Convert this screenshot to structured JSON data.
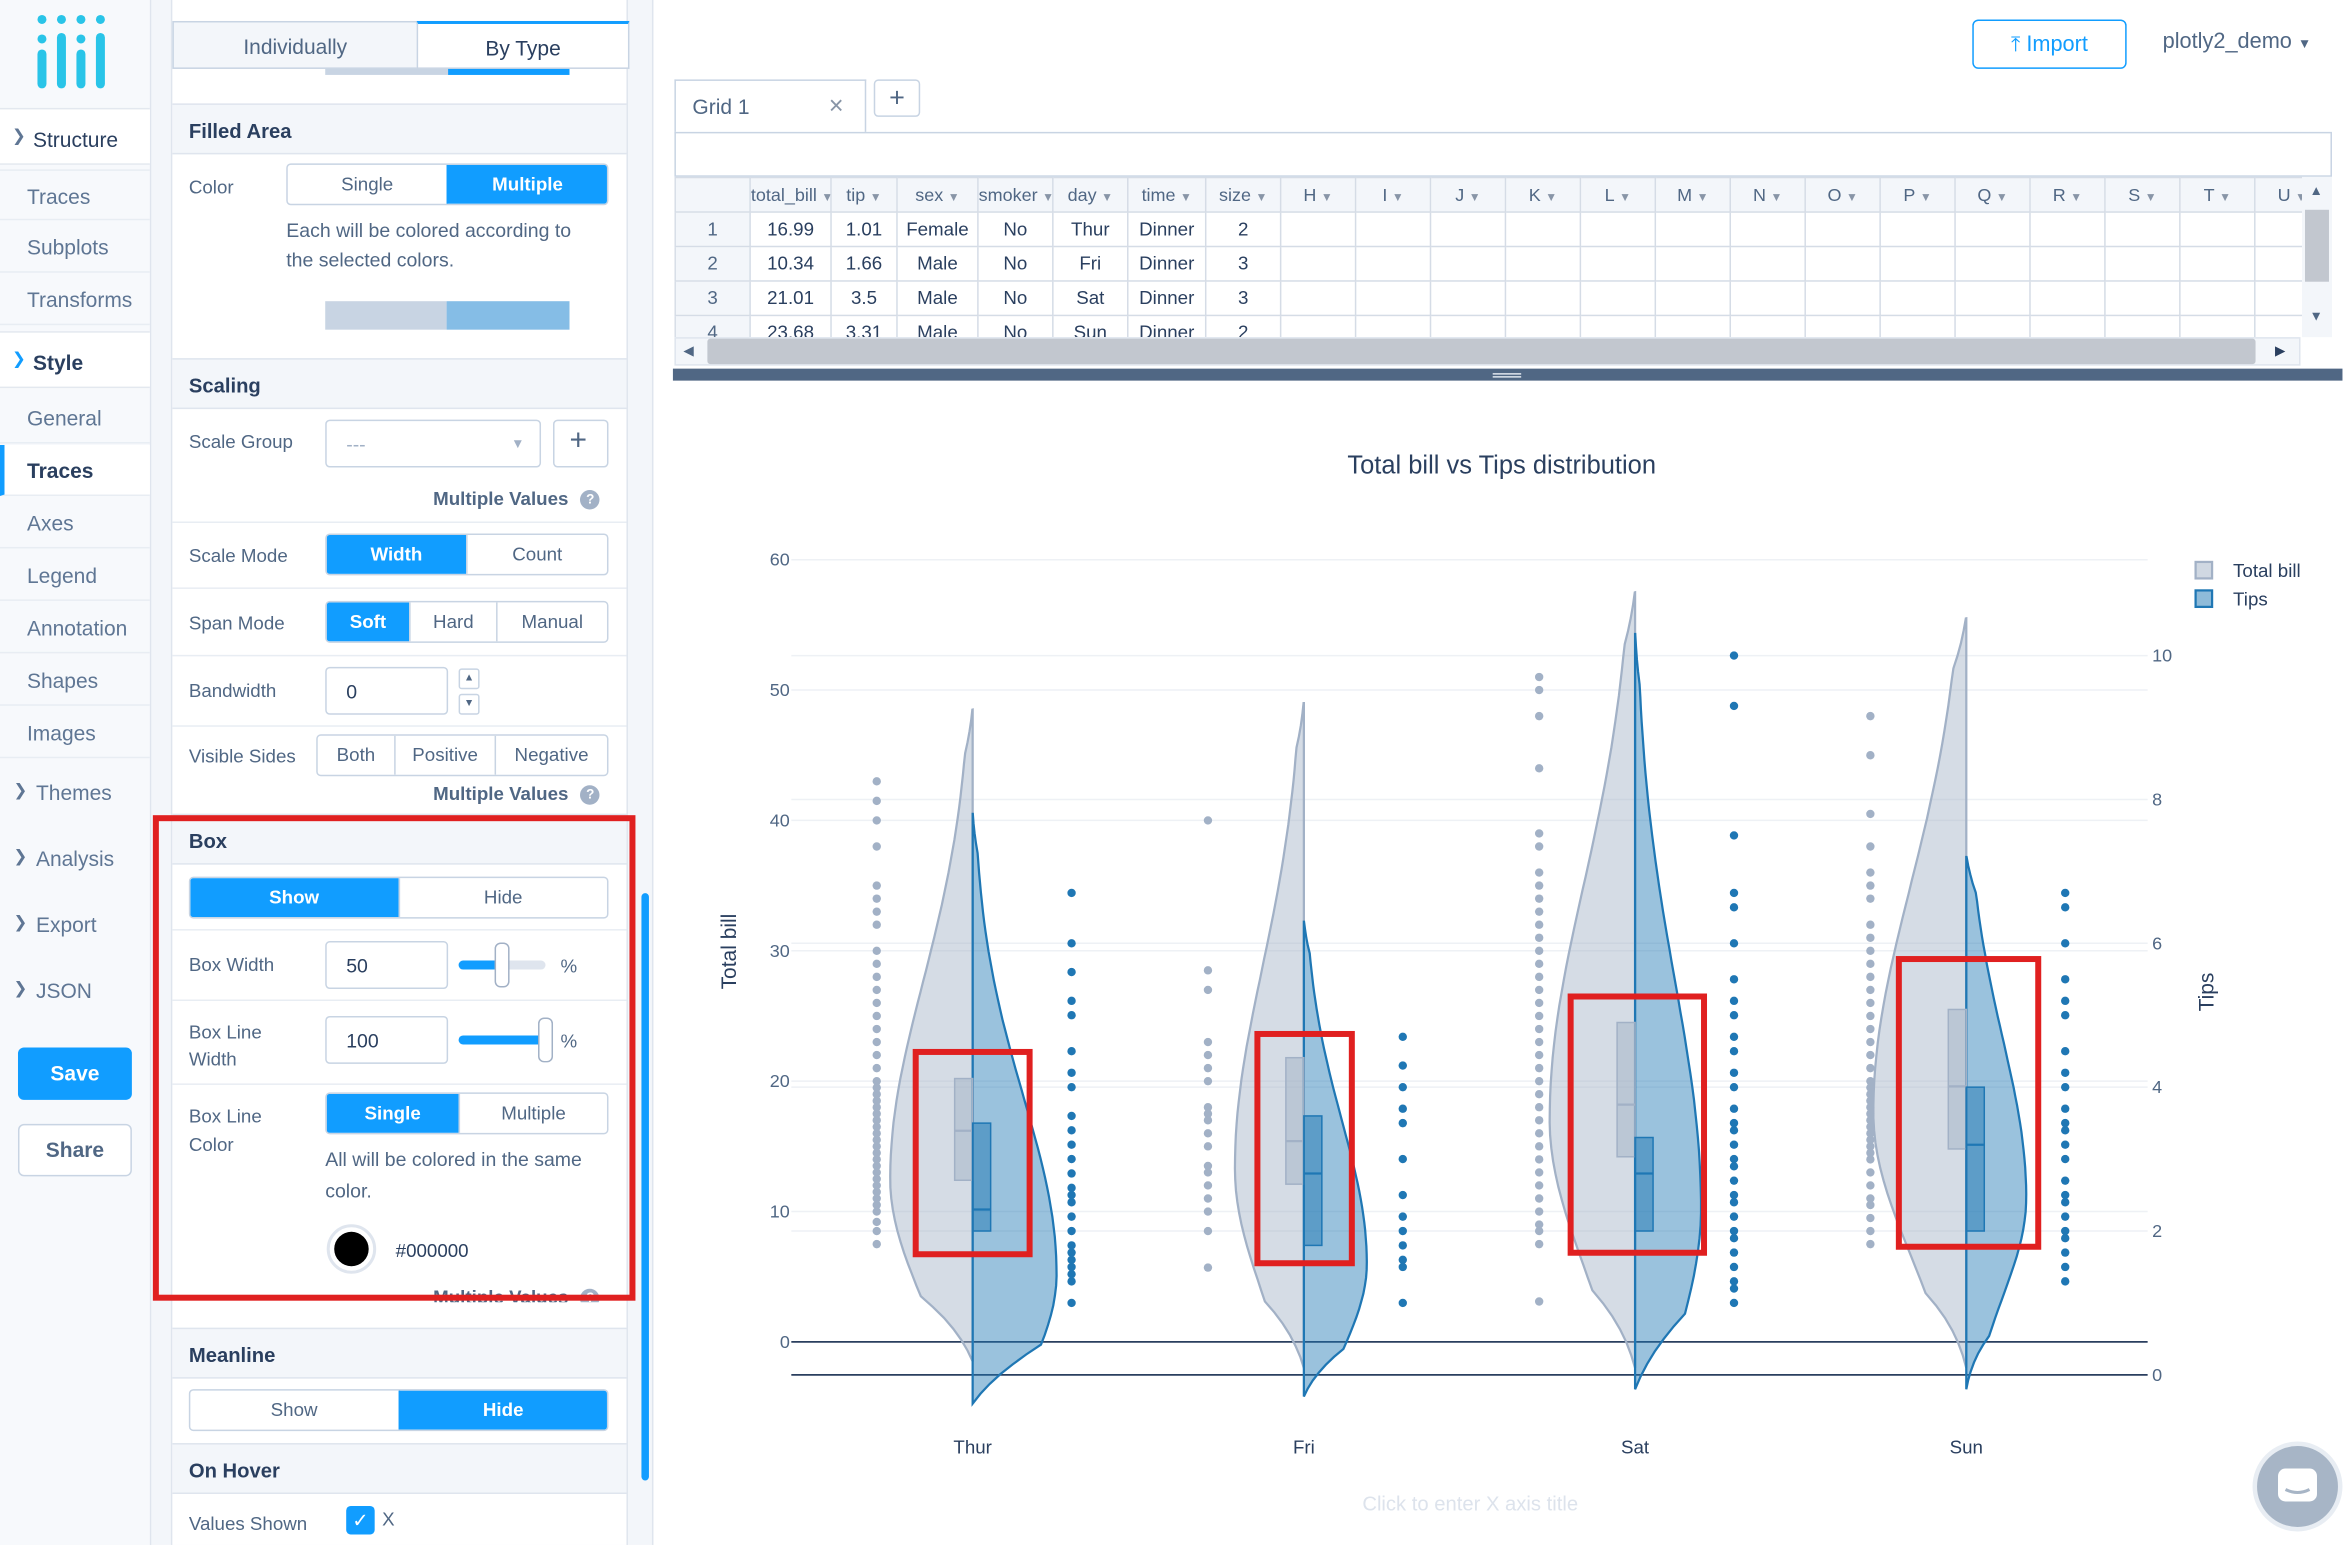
{
  "nav": {
    "structure": {
      "label": "Structure",
      "items": [
        "Traces",
        "Subplots",
        "Transforms"
      ]
    },
    "style": {
      "label": "Style",
      "items": [
        "General",
        "Traces",
        "Axes",
        "Legend",
        "Annotation",
        "Shapes",
        "Images"
      ],
      "active": "Traces"
    },
    "categories": [
      "Themes",
      "Analysis",
      "Export",
      "JSON"
    ],
    "save_label": "Save",
    "share_label": "Share"
  },
  "panel": {
    "tabs": [
      "Individually",
      "By Type"
    ],
    "active_tab": "By Type",
    "filled_area": {
      "title": "Filled Area",
      "color_label": "Color",
      "options": [
        "Single",
        "Multiple"
      ],
      "selected": "Multiple",
      "help": [
        "Each will be colored according to",
        "the selected colors."
      ]
    },
    "scaling": {
      "title": "Scaling",
      "scale_group_label": "Scale Group",
      "scale_group_value": "---",
      "multiple_values_label": "Multiple Values",
      "scale_mode_label": "Scale Mode",
      "scale_mode_options": [
        "Width",
        "Count"
      ],
      "scale_mode_selected": "Width",
      "span_mode_label": "Span Mode",
      "span_mode_options": [
        "Soft",
        "Hard",
        "Manual"
      ],
      "span_mode_selected": "Soft",
      "bandwidth_label": "Bandwidth",
      "bandwidth_value": "0",
      "visible_sides_label": "Visible Sides",
      "visible_sides_options": [
        "Both",
        "Positive",
        "Negative"
      ]
    },
    "box": {
      "title": "Box",
      "visibility_options": [
        "Show",
        "Hide"
      ],
      "visibility_selected": "Show",
      "width_label": "Box Width",
      "width_value": "50",
      "width_level": 0.5,
      "width_unit": "%",
      "line_width_label": [
        "Box Line",
        "Width"
      ],
      "line_width_value": "100",
      "line_width_level": 1.0,
      "line_width_unit": "%",
      "line_color_label": [
        "Box Line",
        "Color"
      ],
      "line_color_options": [
        "Single",
        "Multiple"
      ],
      "line_color_selected": "Single",
      "line_color_help": [
        "All will be colored in the same",
        "color."
      ],
      "line_color_hex": "#000000",
      "multiple_values_label": "Multiple Values"
    },
    "meanline": {
      "title": "Meanline",
      "options": [
        "Show",
        "Hide"
      ],
      "selected": "Hide"
    },
    "on_hover": {
      "title": "On Hover",
      "values_shown_label": "Values Shown",
      "values_shown_x": "X"
    }
  },
  "top": {
    "import_label": "Import",
    "user_label": "plotly2_demo"
  },
  "grid": {
    "tab_label": "Grid 1",
    "columns": [
      "total_bill",
      "tip",
      "sex",
      "smoker",
      "day",
      "time",
      "size",
      "H",
      "I",
      "J",
      "K",
      "L",
      "M",
      "N",
      "O",
      "P",
      "Q",
      "R",
      "S",
      "T",
      "U"
    ],
    "rows": [
      {
        "n": "1",
        "cells": [
          "16.99",
          "1.01",
          "Female",
          "No",
          "Thur",
          "Dinner",
          "2"
        ]
      },
      {
        "n": "2",
        "cells": [
          "10.34",
          "1.66",
          "Male",
          "No",
          "Fri",
          "Dinner",
          "3"
        ]
      },
      {
        "n": "3",
        "cells": [
          "21.01",
          "3.5",
          "Male",
          "No",
          "Sat",
          "Dinner",
          "3"
        ]
      },
      {
        "n": "4",
        "cells": [
          "23.68",
          "3.31",
          "Male",
          "No",
          "Sun",
          "Dinner",
          "2"
        ]
      }
    ]
  },
  "chart_data": {
    "type": "violin",
    "title": "Total bill vs Tips distribution",
    "xlabel_placeholder": "Click to enter X axis title",
    "ylabel": "Total bill",
    "y2label": "Tips",
    "categories": [
      "Thur",
      "Fri",
      "Sat",
      "Sun"
    ],
    "y_ticks": [
      0,
      10,
      20,
      30,
      40,
      50,
      60
    ],
    "y2_ticks": [
      0,
      2,
      4,
      6,
      8,
      10
    ],
    "legend": [
      "Total bill",
      "Tips"
    ],
    "colors": {
      "total_bill": "#a2b1c6",
      "tips": "#1f77b4",
      "highlight": "#e02020"
    },
    "series": [
      {
        "name": "Total bill",
        "axis": "y",
        "side": "negative",
        "box": [
          {
            "q1": 12.4,
            "median": 16.2,
            "q3": 20.2
          },
          {
            "q1": 12.1,
            "median": 15.4,
            "q3": 21.8
          },
          {
            "q1": 14.2,
            "median": 18.2,
            "q3": 24.5
          },
          {
            "q1": 14.8,
            "median": 19.6,
            "q3": 25.5
          }
        ],
        "points": [
          [
            7.5,
            8.5,
            9.2,
            10,
            10.5,
            11,
            11.5,
            12,
            12.5,
            13,
            13.5,
            14,
            14.5,
            15,
            15.5,
            16,
            16.5,
            17,
            17.5,
            18,
            18.5,
            19,
            19.5,
            20,
            21,
            22,
            23,
            24,
            25,
            26,
            27,
            28,
            29,
            30,
            32,
            33,
            34,
            35,
            38,
            40,
            41.5,
            43
          ],
          [
            5.7,
            8.5,
            10,
            11,
            12,
            13,
            13.5,
            15,
            16,
            17,
            17.5,
            18,
            20,
            21,
            22,
            23,
            27,
            28.5,
            40
          ],
          [
            3.1,
            7.5,
            8.5,
            9,
            10,
            11,
            12,
            13,
            14,
            15,
            16,
            17,
            18,
            19,
            20,
            21,
            22,
            23,
            24,
            25,
            26,
            27,
            28,
            29,
            30,
            31,
            32,
            33,
            34,
            35,
            36,
            38,
            39,
            44,
            48,
            50,
            51
          ],
          [
            7.5,
            8.5,
            9.5,
            10.5,
            11,
            12,
            13,
            14,
            14.5,
            15,
            15.5,
            16,
            16.5,
            17,
            17.5,
            18,
            18.5,
            19,
            19.5,
            20,
            21,
            22,
            23,
            24,
            25,
            26,
            27,
            28,
            29,
            30,
            31,
            32,
            34,
            35,
            36,
            38,
            40.5,
            45,
            48
          ]
        ]
      },
      {
        "name": "Tips",
        "axis": "y2",
        "side": "positive",
        "box": [
          {
            "q1": 2.0,
            "median": 2.3,
            "q3": 3.5
          },
          {
            "q1": 1.8,
            "median": 2.8,
            "q3": 3.6
          },
          {
            "q1": 2.0,
            "median": 2.8,
            "q3": 3.3
          },
          {
            "q1": 2.0,
            "median": 3.2,
            "q3": 4.0
          }
        ],
        "points": [
          [
            1.0,
            1.3,
            1.4,
            1.5,
            1.6,
            1.7,
            1.8,
            2.0,
            2.2,
            2.4,
            2.5,
            2.6,
            2.8,
            3.0,
            3.2,
            3.4,
            3.6,
            4.0,
            4.2,
            4.5,
            5.0,
            5.2,
            5.6,
            6.0,
            6.7
          ],
          [
            1.0,
            1.5,
            1.6,
            1.8,
            2.0,
            2.2,
            2.5,
            3.0,
            3.5,
            3.7,
            4.0,
            4.3,
            4.7
          ],
          [
            1.0,
            1.2,
            1.3,
            1.5,
            1.7,
            1.9,
            2.0,
            2.2,
            2.4,
            2.5,
            2.7,
            2.9,
            3.0,
            3.2,
            3.4,
            3.5,
            3.7,
            4.0,
            4.2,
            4.5,
            4.7,
            5.0,
            5.2,
            5.5,
            6.0,
            6.5,
            6.7,
            7.5,
            9.3,
            10.0
          ],
          [
            1.3,
            1.5,
            1.7,
            1.9,
            2.0,
            2.2,
            2.4,
            2.5,
            2.7,
            3.0,
            3.2,
            3.4,
            3.5,
            3.7,
            4.0,
            4.2,
            4.5,
            5.0,
            5.2,
            5.5,
            6.0,
            6.5,
            6.7
          ]
        ]
      }
    ],
    "highlight_boxes": [
      "Thur",
      "Fri",
      "Sat",
      "Sun"
    ]
  }
}
